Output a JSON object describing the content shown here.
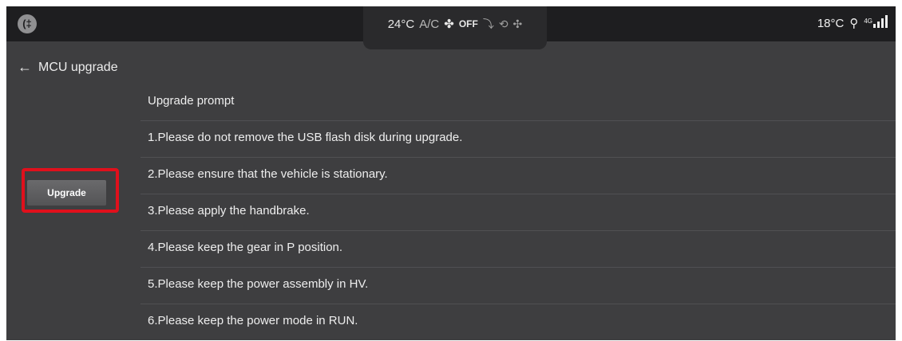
{
  "status_bar": {
    "left_icon": "rear-fog-light-icon",
    "left_glyph": "(‡",
    "temperature_set": "24°C",
    "ac_label": "A/C",
    "fan_state": "OFF",
    "climate_icons": [
      "fan-icon",
      "seat-airflow-icon",
      "recirculation-icon",
      "fan-speed-icon"
    ],
    "outside_temp": "18°C",
    "network_label": "4G",
    "right_icons": [
      "usb-icon",
      "signal-strength-icon"
    ]
  },
  "header": {
    "back_glyph": "←",
    "title": "MCU upgrade"
  },
  "prompt": {
    "title": "Upgrade prompt",
    "items": [
      "1.Please do not remove the USB flash disk during upgrade.",
      "2.Please ensure that the vehicle is stationary.",
      "3.Please apply the handbrake.",
      "4.Please keep the gear in P position.",
      "5.Please keep the power assembly in HV.",
      "6.Please keep the power mode in RUN."
    ]
  },
  "actions": {
    "upgrade_label": "Upgrade"
  },
  "colors": {
    "background": "#3e3e40",
    "status_bar": "#1e1e20",
    "highlight": "#e0101c",
    "button": "#5e5e60",
    "text": "#eeeeee"
  }
}
